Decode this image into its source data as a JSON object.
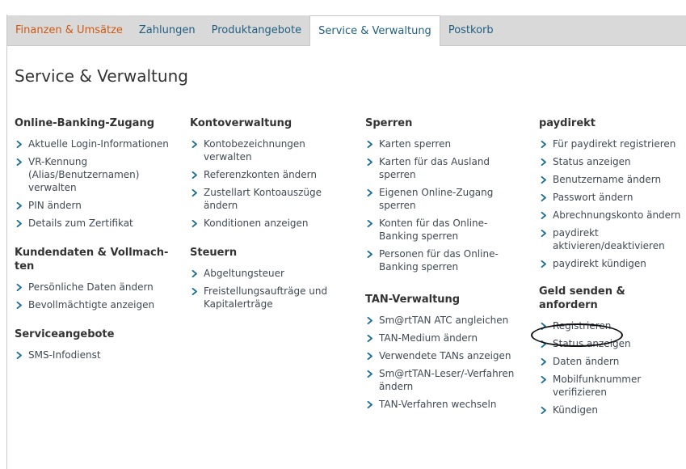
{
  "nav": {
    "tabs": [
      {
        "label": "Finanzen & Umsätze"
      },
      {
        "label": "Zahlungen"
      },
      {
        "label": "Produktangebote"
      },
      {
        "label": "Service & Verwaltung"
      },
      {
        "label": "Postkorb"
      }
    ],
    "active_tab": "Service & Verwaltung"
  },
  "page": {
    "title": "Service & Verwaltung"
  },
  "colors": {
    "link": "#1f5f80",
    "first_tab": "#d05a14",
    "chevron": "#1a6f96",
    "tabbar_bg": "#d9d9d9"
  },
  "sections": {
    "online_banking": {
      "title": "Online-Banking-Zugang",
      "items": [
        "Aktuelle Login-Informationen",
        "VR-Kennung (Alias/Benutzernamen) verwalten",
        "PIN ändern",
        "Details zum Zertifikat"
      ]
    },
    "kundendaten": {
      "title": "Kundendaten & Vollmach-ten",
      "items": [
        "Persönliche Daten ändern",
        "Bevollmächtigte anzeigen"
      ]
    },
    "serviceangebote": {
      "title": "Serviceangebote",
      "items": [
        "SMS-Infodienst"
      ]
    },
    "kontoverwaltung": {
      "title": "Kontoverwaltung",
      "items": [
        "Kontobezeichnungen verwalten",
        "Referenzkonten ändern",
        "Zustellart Kontoauszüge ändern",
        "Konditionen anzeigen"
      ]
    },
    "steuern": {
      "title": "Steuern",
      "items": [
        "Abgeltungsteuer",
        "Freistellungsaufträge und Kapitalerträge"
      ]
    },
    "sperren": {
      "title": "Sperren",
      "items": [
        "Karten sperren",
        "Karten für das Ausland sperren",
        "Eigenen Online-Zugang sperren",
        "Konten für das Online-Banking sperren",
        "Personen für das Online-Banking sperren"
      ]
    },
    "tan": {
      "title": "TAN-Verwaltung",
      "items": [
        "Sm@rtTAN ATC angleichen",
        "TAN-Medium ändern",
        "Verwendete TANs anzeigen",
        "Sm@rtTAN-Leser/-Verfahren ändern",
        "TAN-Verfahren wechseln"
      ]
    },
    "paydirekt": {
      "title": "paydirekt",
      "items": [
        "Für paydirekt registrieren",
        "Status anzeigen",
        "Benutzername ändern",
        "Passwort ändern",
        "Abrechnungskonto ändern",
        "paydirekt aktivieren/deaktivieren",
        "paydirekt kündigen"
      ]
    },
    "geld": {
      "title": "Geld senden & anfordern",
      "items": [
        "Registrieren",
        "Status anzeigen",
        "Daten ändern",
        "Mobilfunknummer verifizieren",
        "Kündigen"
      ]
    }
  }
}
